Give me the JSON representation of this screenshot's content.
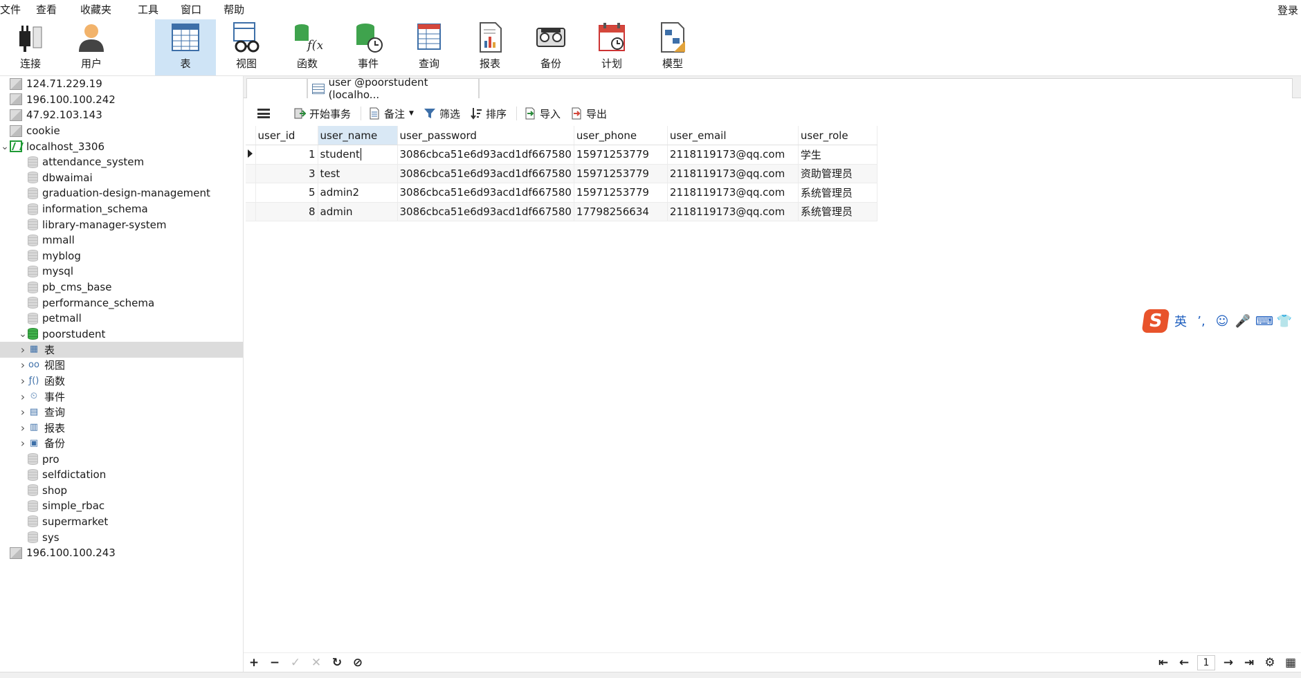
{
  "menu": [
    "文件",
    "查看",
    "收藏夹",
    "工具",
    "窗口",
    "帮助"
  ],
  "login_label": "登录",
  "toolbar": [
    {
      "label": "连接",
      "icon": "connect-plug-icon"
    },
    {
      "label": "用户",
      "icon": "user-icon"
    },
    {
      "label": "表",
      "icon": "table-icon",
      "active": true
    },
    {
      "label": "视图",
      "icon": "view-glasses-icon"
    },
    {
      "label": "函数",
      "icon": "function-icon"
    },
    {
      "label": "事件",
      "icon": "event-clock-icon"
    },
    {
      "label": "查询",
      "icon": "query-icon"
    },
    {
      "label": "报表",
      "icon": "report-icon"
    },
    {
      "label": "备份",
      "icon": "backup-icon"
    },
    {
      "label": "计划",
      "icon": "schedule-calendar-icon"
    },
    {
      "label": "模型",
      "icon": "model-icon"
    }
  ],
  "nav": [
    {
      "label": "124.71.229.19",
      "level": 0,
      "icon": "connection"
    },
    {
      "label": "196.100.100.242",
      "level": 0,
      "icon": "connection"
    },
    {
      "label": "47.92.103.143",
      "level": 0,
      "icon": "connection"
    },
    {
      "label": "cookie",
      "level": 0,
      "icon": "connection"
    },
    {
      "label": "localhost_3306",
      "level": 0,
      "icon": "mysql-green",
      "expanded": true
    },
    {
      "label": "attendance_system",
      "level": 1,
      "icon": "database"
    },
    {
      "label": "dbwaimai",
      "level": 1,
      "icon": "database"
    },
    {
      "label": "graduation-design-management",
      "level": 1,
      "icon": "database"
    },
    {
      "label": "information_schema",
      "level": 1,
      "icon": "database"
    },
    {
      "label": "library-manager-system",
      "level": 1,
      "icon": "database"
    },
    {
      "label": "mmall",
      "level": 1,
      "icon": "database"
    },
    {
      "label": "myblog",
      "level": 1,
      "icon": "database"
    },
    {
      "label": "mysql",
      "level": 1,
      "icon": "database"
    },
    {
      "label": "pb_cms_base",
      "level": 1,
      "icon": "database"
    },
    {
      "label": "performance_schema",
      "level": 1,
      "icon": "database"
    },
    {
      "label": "petmall",
      "level": 1,
      "icon": "database"
    },
    {
      "label": "poorstudent",
      "level": 1,
      "icon": "database-green",
      "expanded": true
    },
    {
      "label": "表",
      "level": 2,
      "icon": "tables",
      "selected": true
    },
    {
      "label": "视图",
      "level": 2,
      "icon": "views"
    },
    {
      "label": "函数",
      "level": 2,
      "icon": "functions"
    },
    {
      "label": "事件",
      "level": 2,
      "icon": "events"
    },
    {
      "label": "查询",
      "level": 2,
      "icon": "queries"
    },
    {
      "label": "报表",
      "level": 2,
      "icon": "reports"
    },
    {
      "label": "备份",
      "level": 2,
      "icon": "backups"
    },
    {
      "label": "pro",
      "level": 1,
      "icon": "database"
    },
    {
      "label": "selfdictation",
      "level": 1,
      "icon": "database"
    },
    {
      "label": "shop",
      "level": 1,
      "icon": "database"
    },
    {
      "label": "simple_rbac",
      "level": 1,
      "icon": "database"
    },
    {
      "label": "supermarket",
      "level": 1,
      "icon": "database"
    },
    {
      "label": "sys",
      "level": 1,
      "icon": "database"
    },
    {
      "label": "196.100.100.243",
      "level": 0,
      "icon": "connection"
    }
  ],
  "tab": {
    "title": "user @poorstudent (localho..."
  },
  "gridbar": {
    "begin_transaction": "开始事务",
    "memo": "备注",
    "filter": "筛选",
    "sort": "排序",
    "import": "导入",
    "export": "导出"
  },
  "table": {
    "columns": [
      "user_id",
      "user_name",
      "user_password",
      "user_phone",
      "user_email",
      "user_role"
    ],
    "rows": [
      [
        "1",
        "student",
        "3086cbca51e6d93acd1df667580",
        "15971253779",
        "2118119173@qq.com",
        "学生"
      ],
      [
        "3",
        "test",
        "3086cbca51e6d93acd1df667580",
        "15971253779",
        "2118119173@qq.com",
        "资助管理员"
      ],
      [
        "5",
        "admin2",
        "3086cbca51e6d93acd1df667580",
        "15971253779",
        "2118119173@qq.com",
        "系统管理员"
      ],
      [
        "8",
        "admin",
        "3086cbca51e6d93acd1df667580",
        "17798256634",
        "2118119173@qq.com",
        "系统管理员"
      ]
    ]
  },
  "ime": {
    "logo": "S",
    "mode": "英",
    "items": [
      "ʼ,",
      "☺",
      "🎤",
      "⌨",
      "👕"
    ]
  },
  "pager": {
    "page": "1"
  }
}
